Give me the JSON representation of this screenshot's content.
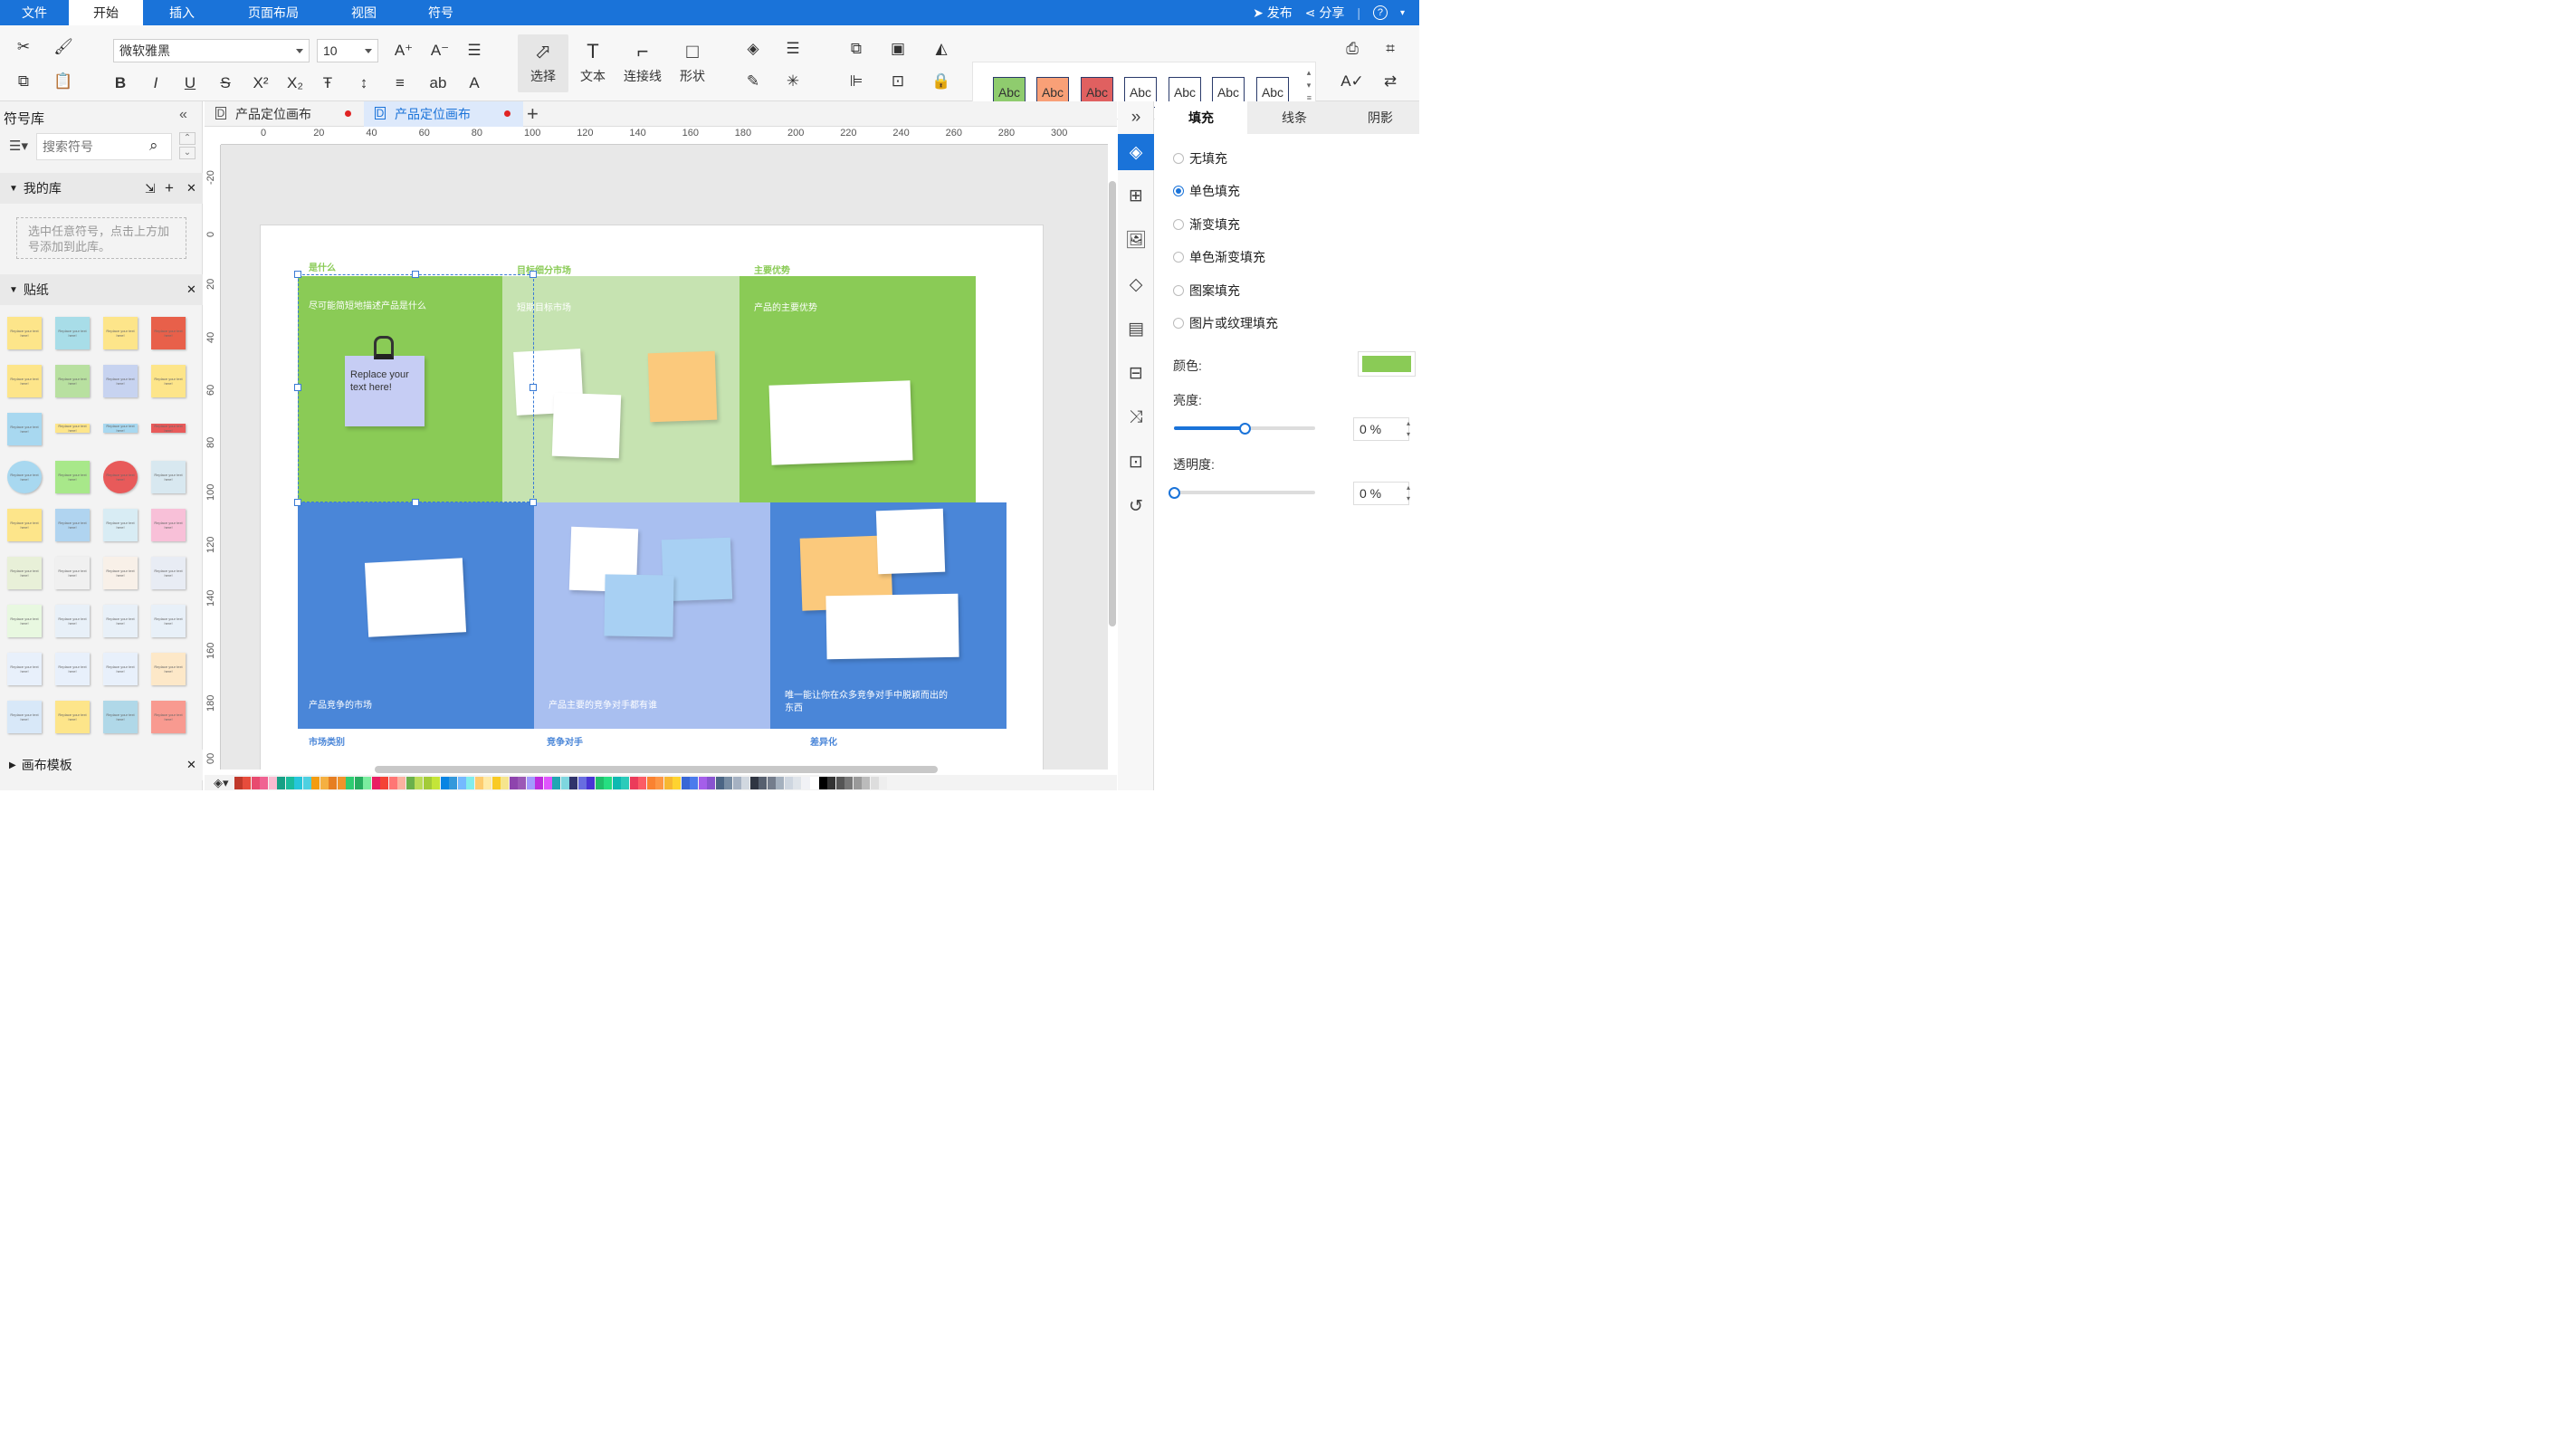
{
  "menu": {
    "items": [
      "文件",
      "开始",
      "插入",
      "页面布局",
      "视图",
      "符号"
    ],
    "active": "开始",
    "publish": "发布",
    "share": "分享",
    "help": "?"
  },
  "toolbar": {
    "font_family": "微软雅黑",
    "font_size": "10",
    "select_label": "选择",
    "text_label": "文本",
    "connector_label": "连接线",
    "shape_label": "形状",
    "style_swatches": [
      {
        "label": "Abc",
        "fill": "#8fcc6e"
      },
      {
        "label": "Abc",
        "fill": "#f9a077"
      },
      {
        "label": "Abc",
        "fill": "#e06060"
      },
      {
        "label": "Abc",
        "fill": "#ffffff"
      },
      {
        "label": "Abc",
        "fill": "#ffffff"
      },
      {
        "label": "Abc",
        "fill": "#ffffff"
      },
      {
        "label": "Abc",
        "fill": "#ffffff"
      }
    ]
  },
  "left_panel": {
    "title": "符号库",
    "search_placeholder": "搜索符号",
    "my_library": "我的库",
    "my_library_hint": "选中任意符号，点击上方加号添加到此库。",
    "stickers_section": "贴纸",
    "templates_section": "画布模板",
    "sticker_text": "Replace your text here!"
  },
  "tabs": [
    {
      "label": "产品定位画布",
      "active": false
    },
    {
      "label": "产品定位画布",
      "active": true
    }
  ],
  "ruler": {
    "h_ticks": [
      "0",
      "20",
      "40",
      "60",
      "80",
      "100",
      "120",
      "140",
      "160",
      "180",
      "200",
      "220",
      "240",
      "260",
      "280",
      "300"
    ],
    "v_ticks": [
      "-20",
      "0",
      "20",
      "40",
      "60",
      "80",
      "100",
      "120",
      "140",
      "160",
      "180",
      "00"
    ]
  },
  "canvas": {
    "top_labels": [
      "是什么",
      "目标细分市场",
      "主要优势"
    ],
    "bottom_labels": [
      "市场类别",
      "竞争对手",
      "差异化"
    ],
    "block_texts": {
      "what": "尽可能简短地描述产品是什么",
      "target": "短期目标市场",
      "advantage": "产品的主要优势",
      "market": "产品竞争的市场",
      "competitors": "产品主要的竞争对手都有谁",
      "differentiation": "唯一能让你在众多竞争对手中脱颖而出的东西"
    },
    "clip_note_text": "Replace your text here!",
    "colors": {
      "green": "#8acb56",
      "light_green": "#c6e3b1",
      "blue": "#4a86d8",
      "light_blue": "#a9bff0",
      "orange_note": "#fbc97c",
      "lavender_note": "#c6cdf4",
      "sky_note": "#a8d0f3"
    }
  },
  "properties": {
    "tabs": [
      "填充",
      "线条",
      "阴影"
    ],
    "active_tab": "填充",
    "fill_options": [
      "无填充",
      "单色填充",
      "渐变填充",
      "单色渐变填充",
      "图案填充",
      "图片或纹理填充"
    ],
    "selected_option": "单色填充",
    "color_label": "颜色:",
    "color_value": "#8acb56",
    "brightness_label": "亮度:",
    "brightness_value": "0 %",
    "brightness_fraction": 0.5,
    "opacity_label": "透明度:",
    "opacity_value": "0 %",
    "opacity_fraction": 0.0
  },
  "palette_colors": [
    "#c0392b",
    "#e74c3c",
    "#e84a6f",
    "#f06292",
    "#f8bbd0",
    "#16a085",
    "#1abc9c",
    "#26c6da",
    "#4dd0e1",
    "#f39c12",
    "#f5b041",
    "#e67e22",
    "#f0932b",
    "#2ecc71",
    "#27ae60",
    "#7bed9f",
    "#e91e63",
    "#f44336",
    "#ff7675",
    "#fab1a0",
    "#6ab04c",
    "#badc58",
    "#a3cb38",
    "#c4e538",
    "#0984e3",
    "#3498db",
    "#74b9ff",
    "#81ecec",
    "#fdcb6e",
    "#ffeaa7",
    "#f9ca24",
    "#f6e58d",
    "#8e44ad",
    "#9b59b6",
    "#a29bfe",
    "#be2edd",
    "#e056fd",
    "#22a6b3",
    "#7ed6df",
    "#30336b",
    "#686de0",
    "#4834d4",
    "#20bf6b",
    "#26de81",
    "#0fb9b1",
    "#2bcbba",
    "#eb3b5a",
    "#fc5c65",
    "#fa8231",
    "#fd9644",
    "#f7b731",
    "#fed330",
    "#3867d6",
    "#4b7bec",
    "#a55eea",
    "#8854d0",
    "#4b6584",
    "#778ca3",
    "#a5b1c2",
    "#d1d8e0",
    "#2f3542",
    "#57606f",
    "#747d8c",
    "#a4b0be",
    "#ced6e0",
    "#dfe4ea",
    "#f1f2f6",
    "#ffffff",
    "#000000",
    "#333333",
    "#555555",
    "#777777",
    "#999999",
    "#bbbbbb",
    "#dddddd",
    "#eeeeee"
  ]
}
